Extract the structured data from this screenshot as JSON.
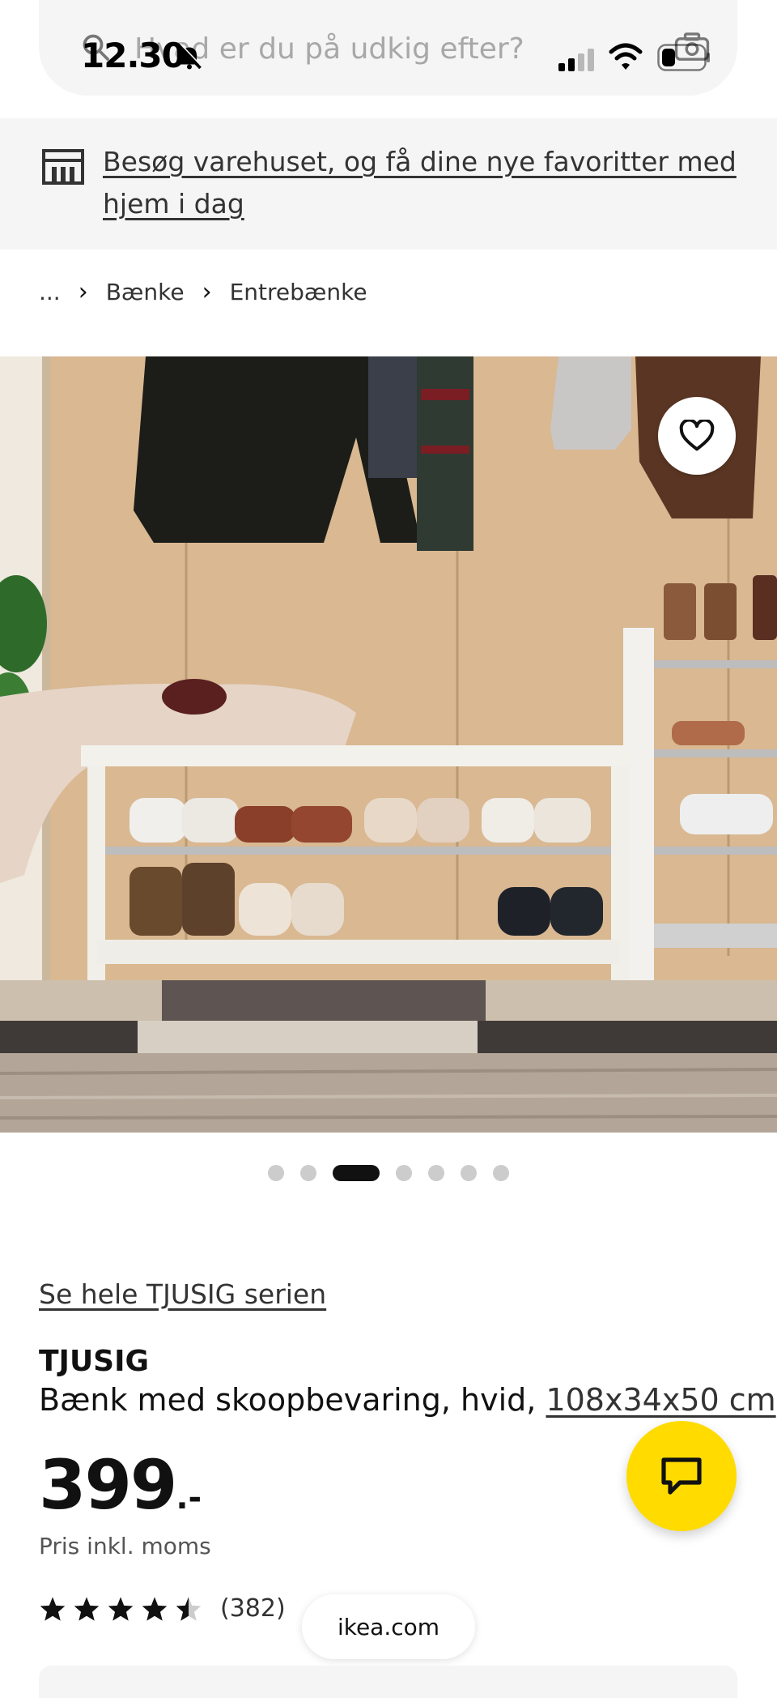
{
  "status_bar": {
    "time": "12.30"
  },
  "search": {
    "placeholder": "Hvad er du på udkig efter?"
  },
  "store_banner": {
    "link_text": "Besøg varehuset, og få dine nye favoritter med hjem i dag"
  },
  "breadcrumb": {
    "items": [
      "...",
      "Bænke",
      "Entrebænke"
    ]
  },
  "carousel": {
    "count": 7,
    "active_index": 2
  },
  "product": {
    "series_link": "Se hele TJUSIG serien",
    "name": "TJUSIG",
    "description": "Bænk med skoopbevaring, hvid, ",
    "dimensions": "108x34x50 cm",
    "price_main": "399",
    "price_suffix": ".-",
    "price_note": "Pris inkl. moms",
    "rating": 4.5,
    "review_count": "(382)"
  },
  "browser": {
    "url": "ikea.com"
  },
  "colors": {
    "accent_yellow": "#ffdb00",
    "banner_bg": "#f5f5f5",
    "text_dark": "#111111"
  }
}
